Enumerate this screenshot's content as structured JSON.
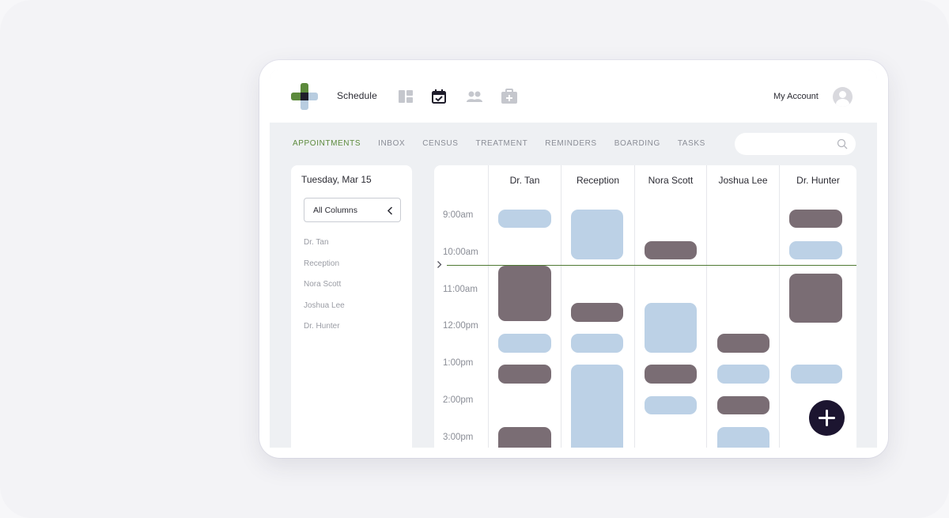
{
  "topbar": {
    "nav_label": "Schedule",
    "icons": [
      "dashboard-icon",
      "calendar-check-icon",
      "people-icon",
      "medical-kit-icon"
    ],
    "account_label": "My Account"
  },
  "tabs": [
    {
      "label": "APPOINTMENTS",
      "active": true
    },
    {
      "label": "INBOX",
      "active": false
    },
    {
      "label": "CENSUS",
      "active": false
    },
    {
      "label": "TREATMENT",
      "active": false
    },
    {
      "label": "REMINDERS",
      "active": false
    },
    {
      "label": "BOARDING",
      "active": false
    },
    {
      "label": "TASKS",
      "active": false
    }
  ],
  "sidebar": {
    "date": "Tuesday, Mar 15",
    "filter_value": "All Columns",
    "items": [
      "Dr. Tan",
      "Reception",
      "Nora Scott",
      "Joshua Lee",
      "Dr. Hunter"
    ]
  },
  "calendar": {
    "columns": [
      "Dr. Tan",
      "Reception",
      "Nora Scott",
      "Joshua Lee",
      "Dr. Hunter"
    ],
    "times": [
      "9:00am",
      "10:00am",
      "11:00am",
      "12:00pm",
      "1:00pm",
      "2:00pm",
      "3:00pm"
    ]
  },
  "colors": {
    "accent": "#5c8a3c",
    "appointment_dark": "#7a6d74",
    "appointment_light": "#bcd1e6",
    "fab": "#1c1530"
  }
}
